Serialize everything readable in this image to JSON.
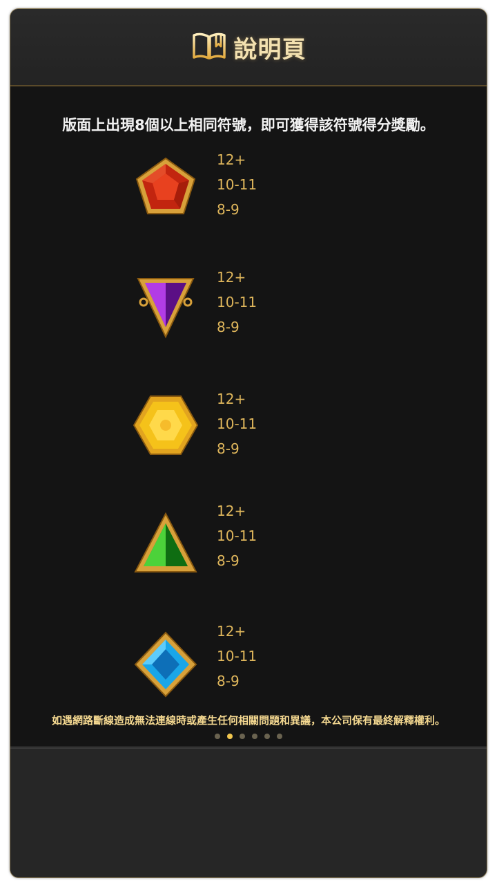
{
  "header": {
    "title": "說明頁",
    "icon": "book-icon"
  },
  "intro": "版面上出現8個以上相同符號，即可獲得該符號得分獎勵。",
  "symbols": [
    {
      "icon": "red-pentagon-gem-icon",
      "pays": [
        "12+",
        "10-11",
        "8-9"
      ]
    },
    {
      "icon": "purple-triangle-gem-icon",
      "pays": [
        "12+",
        "10-11",
        "8-9"
      ]
    },
    {
      "icon": "yellow-hexagon-gem-icon",
      "pays": [
        "12+",
        "10-11",
        "8-9"
      ]
    },
    {
      "icon": "green-triangle-gem-icon",
      "pays": [
        "12+",
        "10-11",
        "8-9"
      ]
    },
    {
      "icon": "blue-diamond-gem-icon",
      "pays": [
        "12+",
        "10-11",
        "8-9"
      ]
    }
  ],
  "disclaimer": "如遇網路斷線造成無法連線時或產生任何相關問題和異議，本公司保有最終解釋權利。",
  "pagination": {
    "total": 6,
    "active": 2
  },
  "colors": {
    "gold": "#e0b75c",
    "title": "#f3e1b0",
    "dot_active": "#f1c64f"
  }
}
